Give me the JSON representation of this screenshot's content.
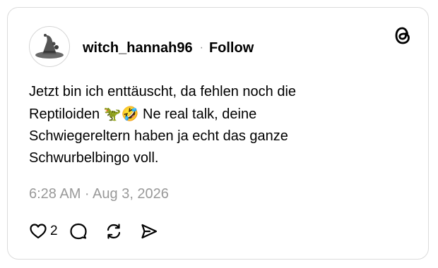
{
  "post": {
    "username": "witch_hannah96",
    "separator": "·",
    "follow_label": "Follow",
    "text_lines": [
      "Jetzt bin ich enttäuscht, da fehlen noch die",
      "Reptiloiden",
      " Ne real talk, deine",
      "Schwiegereltern haben ja echt das ganze",
      "Schwurbelbingo voll."
    ],
    "emojis": [
      "🦖",
      "🤣"
    ],
    "timestamp": "6:28 AM · Aug 3, 2026",
    "like_count": "2"
  },
  "icons": {
    "brand": "threads-logo-icon",
    "avatar": "witch-hat-avatar",
    "like": "heart-icon",
    "reply": "comment-icon",
    "repost": "repost-icon",
    "share": "send-icon"
  },
  "colors": {
    "text": "#000000",
    "muted": "#999999",
    "border": "#dbdbdb"
  }
}
